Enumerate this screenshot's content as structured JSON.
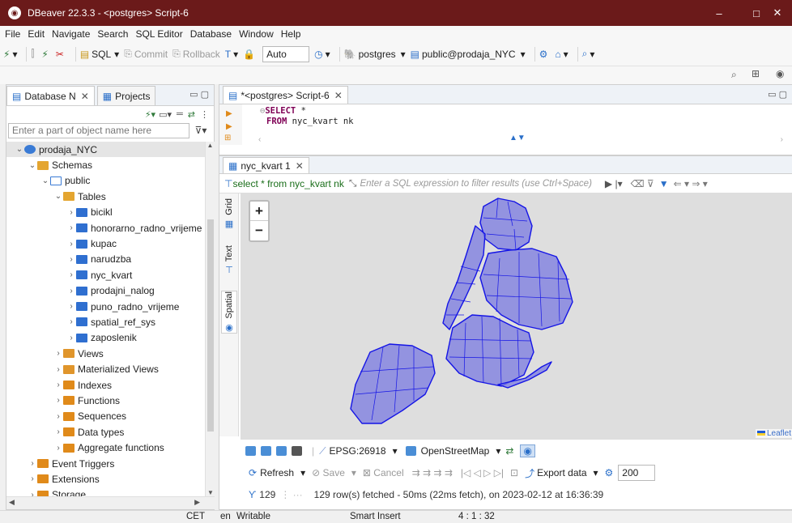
{
  "window": {
    "title": "DBeaver 22.3.3 - <postgres> Script-6",
    "minimize": "–",
    "maximize": "□",
    "close": "✕"
  },
  "menu": [
    "File",
    "Edit",
    "Navigate",
    "Search",
    "SQL Editor",
    "Database",
    "Window",
    "Help"
  ],
  "toolbar": {
    "sql_label": "SQL",
    "commit_label": "Commit",
    "rollback_label": "Rollback",
    "auto_label": "Auto",
    "connection_label": "postgres",
    "schema_label": "public@prodaja_NYC"
  },
  "left_panel": {
    "tabs": [
      {
        "label": "Database N",
        "close": "✕"
      },
      {
        "label": "Projects"
      }
    ],
    "filter_placeholder": "Enter a part of object name here",
    "tree": [
      {
        "label": "prodaja_NYC",
        "depth": 0,
        "icon": "db",
        "expanded": true
      },
      {
        "label": "Schemas",
        "depth": 1,
        "icon": "folder",
        "expanded": true
      },
      {
        "label": "public",
        "depth": 2,
        "icon": "schema",
        "expanded": true
      },
      {
        "label": "Tables",
        "depth": 3,
        "icon": "folder",
        "expanded": true
      },
      {
        "label": "bicikl",
        "depth": 4,
        "icon": "table"
      },
      {
        "label": "honorarno_radno_vrijeme",
        "depth": 4,
        "icon": "table"
      },
      {
        "label": "kupac",
        "depth": 4,
        "icon": "table"
      },
      {
        "label": "narudzba",
        "depth": 4,
        "icon": "table"
      },
      {
        "label": "nyc_kvart",
        "depth": 4,
        "icon": "table"
      },
      {
        "label": "prodajni_nalog",
        "depth": 4,
        "icon": "table"
      },
      {
        "label": "puno_radno_vrijeme",
        "depth": 4,
        "icon": "table"
      },
      {
        "label": "spatial_ref_sys",
        "depth": 4,
        "icon": "table"
      },
      {
        "label": "zaposlenik",
        "depth": 4,
        "icon": "table"
      },
      {
        "label": "Views",
        "depth": 3,
        "icon": "view"
      },
      {
        "label": "Materialized Views",
        "depth": 3,
        "icon": "view"
      },
      {
        "label": "Indexes",
        "depth": 3,
        "icon": "folderorange"
      },
      {
        "label": "Functions",
        "depth": 3,
        "icon": "folderorange"
      },
      {
        "label": "Sequences",
        "depth": 3,
        "icon": "folderorange"
      },
      {
        "label": "Data types",
        "depth": 3,
        "icon": "folderorange"
      },
      {
        "label": "Aggregate functions",
        "depth": 3,
        "icon": "folderorange"
      },
      {
        "label": "Event Triggers",
        "depth": 1,
        "icon": "folderorange"
      },
      {
        "label": "Extensions",
        "depth": 1,
        "icon": "folderorange"
      },
      {
        "label": "Storage",
        "depth": 1,
        "icon": "folderorange"
      }
    ]
  },
  "editor": {
    "tab_label": "*<postgres> Script-6",
    "line1_kw": "SELECT",
    "line1_rest": " *",
    "line2_kw": "FROM",
    "line2_rest": " nyc_kvart nk"
  },
  "results": {
    "tab_label": "nyc_kvart 1",
    "query": "select * from nyc_kvart nk",
    "filter_placeholder": "Enter a SQL expression to filter results (use Ctrl+Space)",
    "side_tabs": [
      "Grid",
      "Text",
      "Spatial"
    ],
    "zoom_in": "+",
    "zoom_out": "−",
    "attribution": "Leaflet",
    "crs": "EPSG:26918",
    "tile_layer": "OpenStreetMap",
    "refresh": "Refresh",
    "save": "Save",
    "cancel": "Cancel",
    "export": "Export data",
    "fetch_size": "200",
    "row_count": "129",
    "status": "129 row(s) fetched - 50ms (22ms fetch), on 2023-02-12 at 16:36:39"
  },
  "statusbar": {
    "timezone": "CET",
    "locale": "en",
    "mode": "Writable",
    "insert": "Smart Insert",
    "position": "4 : 1 : 32"
  },
  "colors": {
    "title_bar": "#6b1a1a",
    "polygon_stroke": "#1414e6",
    "polygon_fill": "#7a7ae0",
    "map_bg": "#dedede"
  }
}
